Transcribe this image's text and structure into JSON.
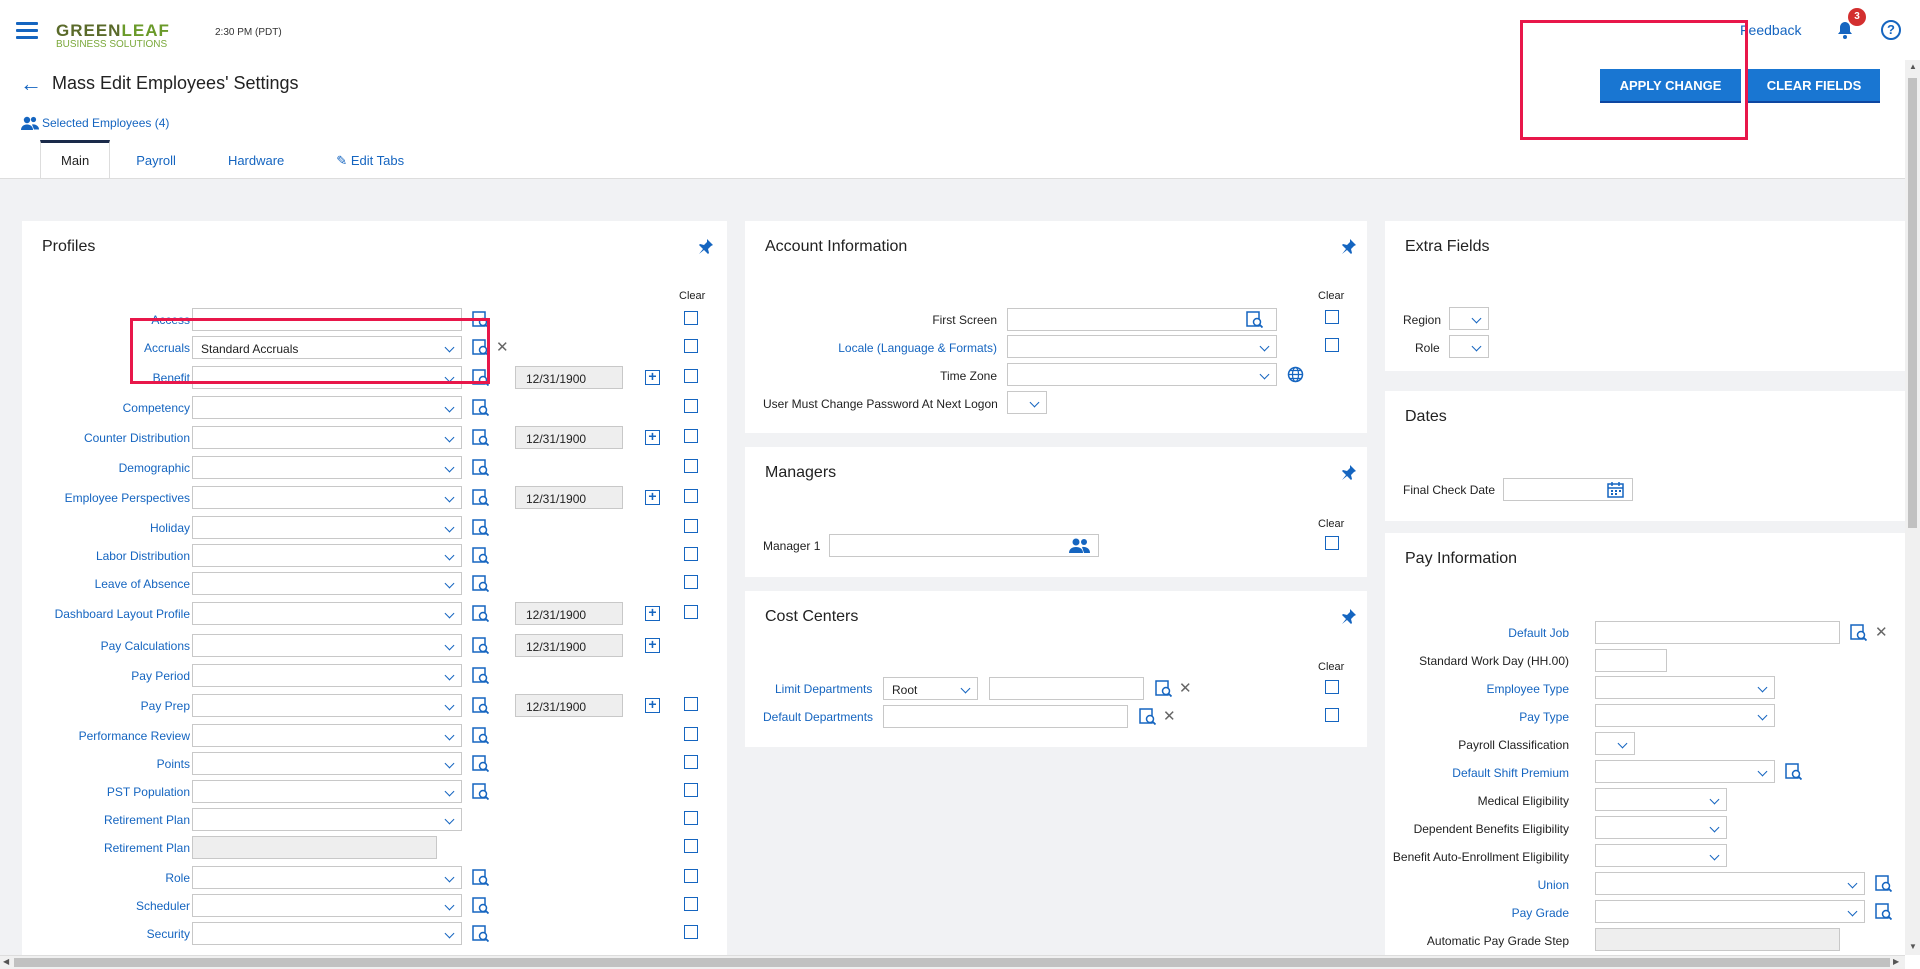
{
  "header": {
    "logo_top": "GREEN",
    "logo_leaf": "LEAF",
    "logo_bottom": "BUSINESS SOLUTIONS",
    "time": "2:30 PM (PDT)",
    "feedback": "Feedback",
    "notification_count": "3",
    "help": "?"
  },
  "page": {
    "title": "Mass Edit Employees' Settings",
    "selected_employees": "Selected Employees (4)",
    "apply_button": "APPLY CHANGE",
    "clear_button": "CLEAR FIELDS"
  },
  "tabs": [
    "Main",
    "Payroll",
    "Hardware",
    "Edit Tabs"
  ],
  "profiles": {
    "title": "Profiles",
    "clear_header": "Clear",
    "rows": [
      {
        "label": "Access",
        "value": "",
        "date": "",
        "has_chev": false
      },
      {
        "label": "Accruals",
        "value": "Standard Accruals",
        "date": ""
      },
      {
        "label": "Benefit",
        "value": "",
        "date": "12/31/1900"
      },
      {
        "label": "Competency",
        "value": "",
        "date": ""
      },
      {
        "label": "Counter Distribution",
        "value": "",
        "date": "12/31/1900"
      },
      {
        "label": "Demographic",
        "value": "",
        "date": ""
      },
      {
        "label": "Employee Perspectives",
        "value": "",
        "date": "12/31/1900"
      },
      {
        "label": "Holiday",
        "value": "",
        "date": ""
      },
      {
        "label": "Labor Distribution",
        "value": "",
        "date": ""
      },
      {
        "label": "Leave of Absence",
        "value": "",
        "date": ""
      },
      {
        "label": "Dashboard Layout Profile",
        "value": "",
        "date": "12/31/1900"
      },
      {
        "label": "Pay Calculations",
        "value": "",
        "date": "12/31/1900"
      },
      {
        "label": "Pay Period",
        "value": "",
        "date": ""
      },
      {
        "label": "Pay Prep",
        "value": "",
        "date": "12/31/1900"
      },
      {
        "label": "Performance Review",
        "value": "",
        "date": ""
      },
      {
        "label": "Points",
        "value": "",
        "date": ""
      },
      {
        "label": "PST Population",
        "value": "",
        "date": ""
      },
      {
        "label": "Retirement Plan",
        "value": "",
        "date": ""
      },
      {
        "label": "Retirement Plan",
        "value": "",
        "date": ""
      },
      {
        "label": "Role",
        "value": "",
        "date": ""
      },
      {
        "label": "Scheduler",
        "value": "",
        "date": ""
      },
      {
        "label": "Security",
        "value": "",
        "date": ""
      }
    ]
  },
  "account": {
    "title": "Account Information",
    "clear_header": "Clear",
    "first_screen": "First Screen",
    "locale": "Locale (Language & Formats)",
    "time_zone": "Time Zone",
    "must_change_pw": "User Must Change Password At Next Logon"
  },
  "managers": {
    "title": "Managers",
    "clear_header": "Clear",
    "manager1": "Manager 1"
  },
  "cost_centers": {
    "title": "Cost Centers",
    "clear_header": "Clear",
    "limit_departments": "Limit Departments",
    "limit_value": "Root",
    "default_departments": "Default Departments"
  },
  "extra_fields": {
    "title": "Extra Fields",
    "region": "Region",
    "role": "Role"
  },
  "dates": {
    "title": "Dates",
    "final_check_date": "Final Check Date"
  },
  "pay_info": {
    "title": "Pay Information",
    "default_job": "Default Job",
    "standard_work_day": "Standard Work Day (HH.00)",
    "employee_type": "Employee Type",
    "pay_type": "Pay Type",
    "payroll_classification": "Payroll Classification",
    "default_shift_premium": "Default Shift Premium",
    "medical_eligibility": "Medical Eligibility",
    "dependent_benefits": "Dependent Benefits Eligibility",
    "benefit_auto_enroll": "Benefit Auto-Enrollment Eligibility",
    "union": "Union",
    "pay_grade": "Pay Grade",
    "automatic_pay_grade_step": "Automatic Pay Grade Step"
  }
}
